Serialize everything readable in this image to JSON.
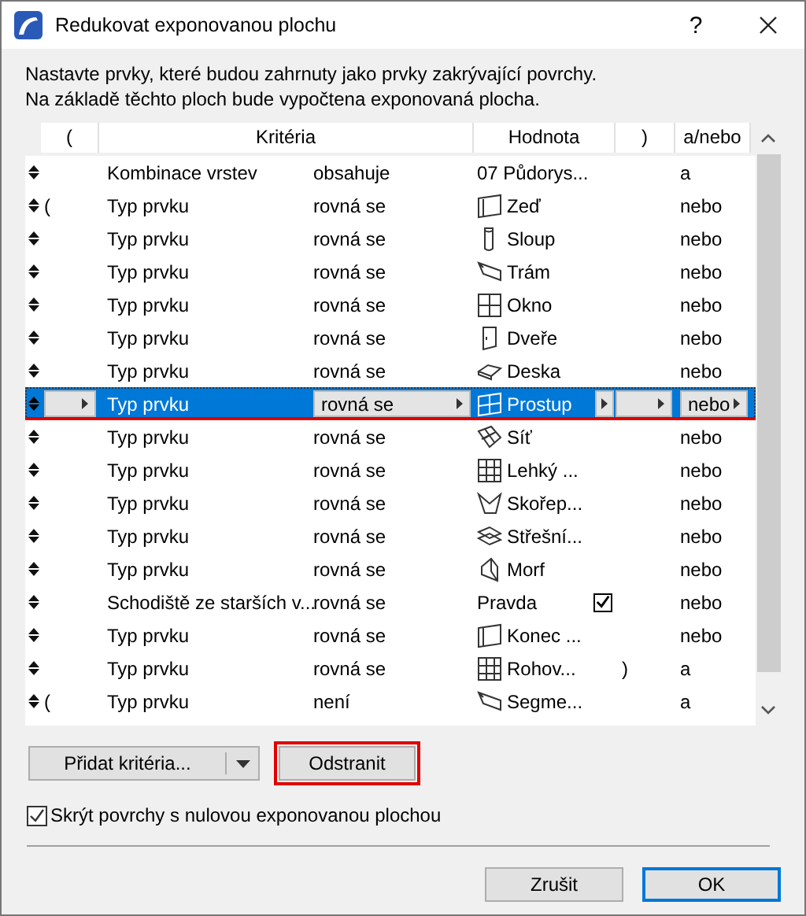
{
  "window": {
    "title": "Redukovat exponovanou plochu",
    "help": "?"
  },
  "description": [
    "Nastavte prvky, které budou zahrnuty jako prvky zakrývající povrchy.",
    "Na základě těchto ploch bude vypočtena exponovaná plocha."
  ],
  "table": {
    "columns": [
      "(",
      "Kritéria",
      "Hodnota",
      ")",
      "a/nebo"
    ],
    "rows": [
      {
        "open": "",
        "criterion": "Kombinace vrstev",
        "operator": "obsahuje",
        "value": "07 Půdorys...",
        "kind": "text",
        "close": "",
        "logic": "a",
        "selected": false,
        "struck": false
      },
      {
        "open": "(",
        "criterion": "Typ prvku",
        "operator": "rovná se",
        "value": "Zeď",
        "kind": "element",
        "close": "",
        "logic": "nebo",
        "selected": false,
        "struck": false
      },
      {
        "open": "",
        "criterion": "Typ prvku",
        "operator": "rovná se",
        "value": "Sloup",
        "kind": "element",
        "close": "",
        "logic": "nebo",
        "selected": false,
        "struck": false
      },
      {
        "open": "",
        "criterion": "Typ prvku",
        "operator": "rovná se",
        "value": "Trám",
        "kind": "element",
        "close": "",
        "logic": "nebo",
        "selected": false,
        "struck": false
      },
      {
        "open": "",
        "criterion": "Typ prvku",
        "operator": "rovná se",
        "value": "Okno",
        "kind": "element",
        "close": "",
        "logic": "nebo",
        "selected": false,
        "struck": false
      },
      {
        "open": "",
        "criterion": "Typ prvku",
        "operator": "rovná se",
        "value": "Dveře",
        "kind": "element",
        "close": "",
        "logic": "nebo",
        "selected": false,
        "struck": false
      },
      {
        "open": "",
        "criterion": "Typ prvku",
        "operator": "rovná se",
        "value": "Deska",
        "kind": "element",
        "close": "",
        "logic": "nebo",
        "selected": false,
        "struck": false
      },
      {
        "open": "",
        "criterion": "Typ prvku",
        "operator": "rovná se",
        "value": "Prostup",
        "kind": "element",
        "close": "",
        "logic": "nebo",
        "selected": true,
        "struck": true
      },
      {
        "open": "",
        "criterion": "Typ prvku",
        "operator": "rovná se",
        "value": "Síť",
        "kind": "element",
        "close": "",
        "logic": "nebo",
        "selected": false,
        "struck": false
      },
      {
        "open": "",
        "criterion": "Typ prvku",
        "operator": "rovná se",
        "value": "Lehký ...",
        "kind": "element",
        "close": "",
        "logic": "nebo",
        "selected": false,
        "struck": false
      },
      {
        "open": "",
        "criterion": "Typ prvku",
        "operator": "rovná se",
        "value": "Skořep...",
        "kind": "element",
        "close": "",
        "logic": "nebo",
        "selected": false,
        "struck": false
      },
      {
        "open": "",
        "criterion": "Typ prvku",
        "operator": "rovná se",
        "value": "Střešní...",
        "kind": "element",
        "close": "",
        "logic": "nebo",
        "selected": false,
        "struck": false
      },
      {
        "open": "",
        "criterion": "Typ prvku",
        "operator": "rovná se",
        "value": "Morf",
        "kind": "element",
        "close": "",
        "logic": "nebo",
        "selected": false,
        "struck": false
      },
      {
        "open": "",
        "criterion": "Schodiště ze starších v...",
        "operator": "rovná se",
        "value": "Pravda",
        "kind": "bool",
        "checked": true,
        "close": "",
        "logic": "nebo",
        "selected": false,
        "struck": false
      },
      {
        "open": "",
        "criterion": "Typ prvku",
        "operator": "rovná se",
        "value": "Konec ...",
        "kind": "element",
        "close": "",
        "logic": "nebo",
        "selected": false,
        "struck": false
      },
      {
        "open": "",
        "criterion": "Typ prvku",
        "operator": "rovná se",
        "value": "Rohov...",
        "kind": "element",
        "close": ")",
        "logic": "a",
        "selected": false,
        "struck": false
      },
      {
        "open": "(",
        "criterion": "Typ prvku",
        "operator": "není",
        "value": "Segme...",
        "kind": "element",
        "close": "",
        "logic": "a",
        "selected": false,
        "struck": false
      }
    ]
  },
  "buttons": {
    "add": "Přidat kritéria...",
    "remove": {
      "label": "Odstranit",
      "highlighted": true
    }
  },
  "hide_option": {
    "label": "Skrýt povrchy s nulovou exponovanou plochou",
    "checked": true
  },
  "footer": [
    {
      "label": "Zrušit",
      "default": false
    },
    {
      "label": "OK",
      "default": true
    }
  ]
}
